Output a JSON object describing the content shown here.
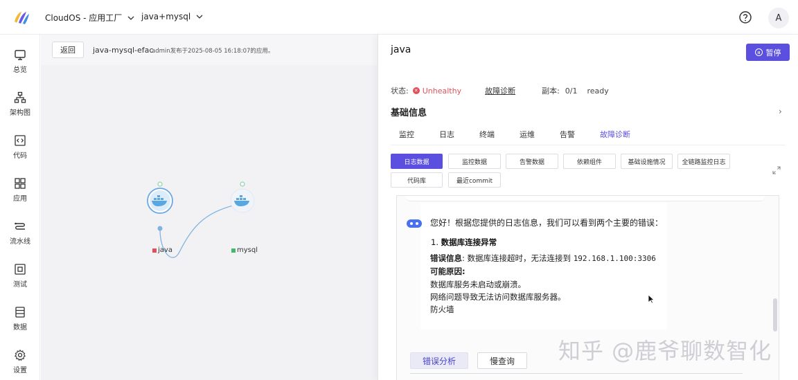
{
  "header": {
    "org_selector": "CloudOS - 应用工厂",
    "project_selector": "java+mysql",
    "avatar_initial": "A"
  },
  "sidebar": {
    "items": [
      {
        "label": "总览",
        "icon": "monitor-icon"
      },
      {
        "label": "架构图",
        "icon": "architecture-icon"
      },
      {
        "label": "代码",
        "icon": "code-icon"
      },
      {
        "label": "应用",
        "icon": "apps-grid-icon"
      },
      {
        "label": "流水线",
        "icon": "pipeline-icon"
      },
      {
        "label": "测试",
        "icon": "test-icon"
      },
      {
        "label": "数据",
        "icon": "data-icon"
      },
      {
        "label": "设置",
        "icon": "gear-icon"
      }
    ]
  },
  "main": {
    "back_label": "返回",
    "app_name": "java-mysql-efac",
    "app_meta": "admin发布于2025-08-05 16:18:07的应用。",
    "nodes": [
      {
        "name": "java",
        "status_color": "#e0505a"
      },
      {
        "name": "mysql",
        "status_color": "#43b86a"
      }
    ]
  },
  "panel": {
    "title": "java",
    "pause_label": "暂停",
    "status_label": "状态:",
    "status_value": "Unhealthy",
    "diagnose_link": "故障诊断",
    "replica_label": "副本:",
    "replica_value": "0/1",
    "ready_text": "ready",
    "section_title": "基础信息",
    "tabs": [
      "监控",
      "日志",
      "终端",
      "运维",
      "告警",
      "故障诊断"
    ],
    "active_tab": 5,
    "subtabs": [
      "日志数据",
      "监控数据",
      "告警数据",
      "依赖组件",
      "基础设施情况",
      "全链路监控日志",
      "代码库",
      "最近commit"
    ],
    "active_subtab": 0,
    "chat": {
      "greeting": "您好！根据您提供的日志信息，我们可以看到两个主要的错误：",
      "heading_num": "1.",
      "heading_text": "数据库连接异常",
      "error_label": "错误信息",
      "error_text": ": 数据库连接超时，无法连接到",
      "error_addr": "192.168.1.100:3306",
      "cause_label": "可能原因:",
      "causes": [
        "数据库服务未启动或崩溃。",
        "网络问题导致无法访问数据库服务器。",
        "防火墙"
      ]
    },
    "chips": [
      "错误分析",
      "慢查询"
    ]
  },
  "watermark": "知乎 @鹿爷聊数智化",
  "colors": {
    "accent": "#5b4fe0",
    "error": "#e0505a",
    "ok": "#43b86a"
  }
}
